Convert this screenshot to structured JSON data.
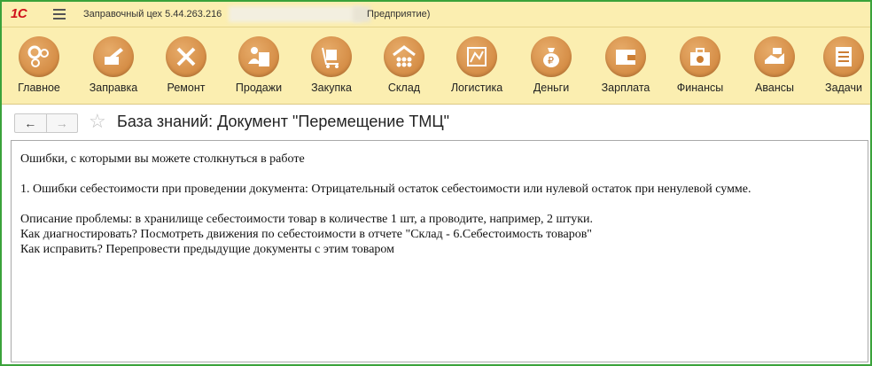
{
  "titlebar": {
    "logo": "1С",
    "title": "Заправочный цех 5.44.263.216",
    "title_tail": "Предприятие)"
  },
  "sections": [
    {
      "label": "Главное",
      "icon": "gears-icon"
    },
    {
      "label": "Заправка",
      "icon": "refill-icon"
    },
    {
      "label": "Ремонт",
      "icon": "tools-icon"
    },
    {
      "label": "Продажи",
      "icon": "sale-icon"
    },
    {
      "label": "Закупка",
      "icon": "cart-icon"
    },
    {
      "label": "Склад",
      "icon": "warehouse-icon"
    },
    {
      "label": "Логистика",
      "icon": "map-icon"
    },
    {
      "label": "Деньги",
      "icon": "money-bag-icon"
    },
    {
      "label": "Зарплата",
      "icon": "wallet-icon"
    },
    {
      "label": "Финансы",
      "icon": "briefcase-icon"
    },
    {
      "label": "Авансы",
      "icon": "advance-icon"
    },
    {
      "label": "Задачи",
      "icon": "tasks-icon"
    }
  ],
  "doc": {
    "title": "База знаний: Документ \"Перемещение ТМЦ\"",
    "back_icon": "←",
    "forward_icon": "→",
    "star_icon": "☆"
  },
  "content": {
    "heading": "Ошибки, с которыми вы можете столкнуться в работе",
    "item1": "1. Ошибки себестоимости при проведении документа: Отрицательный остаток себестоимости или нулевой остаток при ненулевой сумме.",
    "problem": "Описание проблемы: в хранилище себестоимости товар в количестве 1 шт, а проводите,  например, 2 штуки.",
    "diagnose": "Как диагностировать? Посмотреть движения по себестоимости в отчете \"Склад - 6.Себестоимость товаров\"",
    "fix": "Как исправить? Перепровести предыдущие документы с этим товаром"
  },
  "colors": {
    "panel_bg": "#fbeeb0",
    "icon_circle": "#d98c45",
    "frame": "#3aa23a",
    "logo": "#d0111b"
  }
}
